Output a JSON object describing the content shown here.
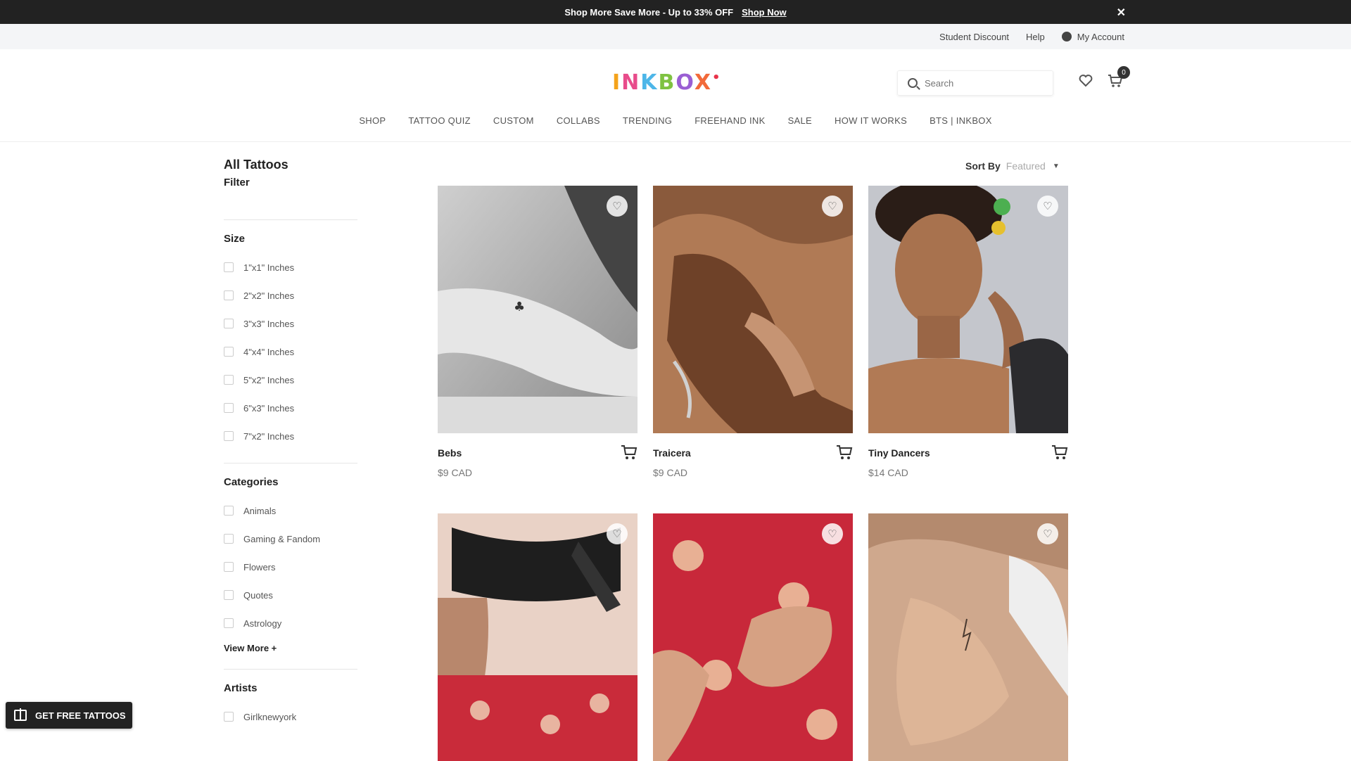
{
  "promo": {
    "text": "Shop More Save More - Up to 33% OFF",
    "link": "Shop Now",
    "close": "✕"
  },
  "utility": {
    "student_discount": "Student Discount",
    "help": "Help",
    "account": "My Account"
  },
  "header": {
    "logo": [
      "I",
      "N",
      "K",
      "B",
      "O",
      "X"
    ],
    "logo_dot": "•",
    "search_placeholder": "Search",
    "cart_count": "0"
  },
  "nav": [
    "SHOP",
    "TATTOO QUIZ",
    "CUSTOM",
    "COLLABS",
    "TRENDING",
    "FREEHAND INK",
    "SALE",
    "HOW IT WORKS",
    "BTS | INKBOX"
  ],
  "sidebar": {
    "title": "All Tattoos",
    "filter": "Filter",
    "size_title": "Size",
    "sizes": [
      "1\"x1\" Inches",
      "2\"x2\" Inches",
      "3\"x3\" Inches",
      "4\"x4\" Inches",
      "5\"x2\" Inches",
      "6\"x3\" Inches",
      "7\"x2\" Inches"
    ],
    "categories_title": "Categories",
    "categories": [
      "Animals",
      "Gaming & Fandom",
      "Flowers",
      "Quotes",
      "Astrology"
    ],
    "view_more": "View More +",
    "artists_title": "Artists",
    "artists": [
      "Girlknewyork"
    ]
  },
  "sort": {
    "label": "Sort By",
    "value": "Featured"
  },
  "products": [
    {
      "name": "Bebs",
      "price": "$9 CAD"
    },
    {
      "name": "Traicera",
      "price": "$9 CAD"
    },
    {
      "name": "Tiny Dancers",
      "price": "$14 CAD"
    },
    {
      "name": "",
      "price": ""
    },
    {
      "name": "",
      "price": ""
    },
    {
      "name": "",
      "price": ""
    }
  ],
  "gift_button": "GET FREE TATTOOS",
  "colors": {
    "promo_bg": "#222222",
    "utility_bg": "#f4f5f7",
    "accent": "#222222"
  }
}
